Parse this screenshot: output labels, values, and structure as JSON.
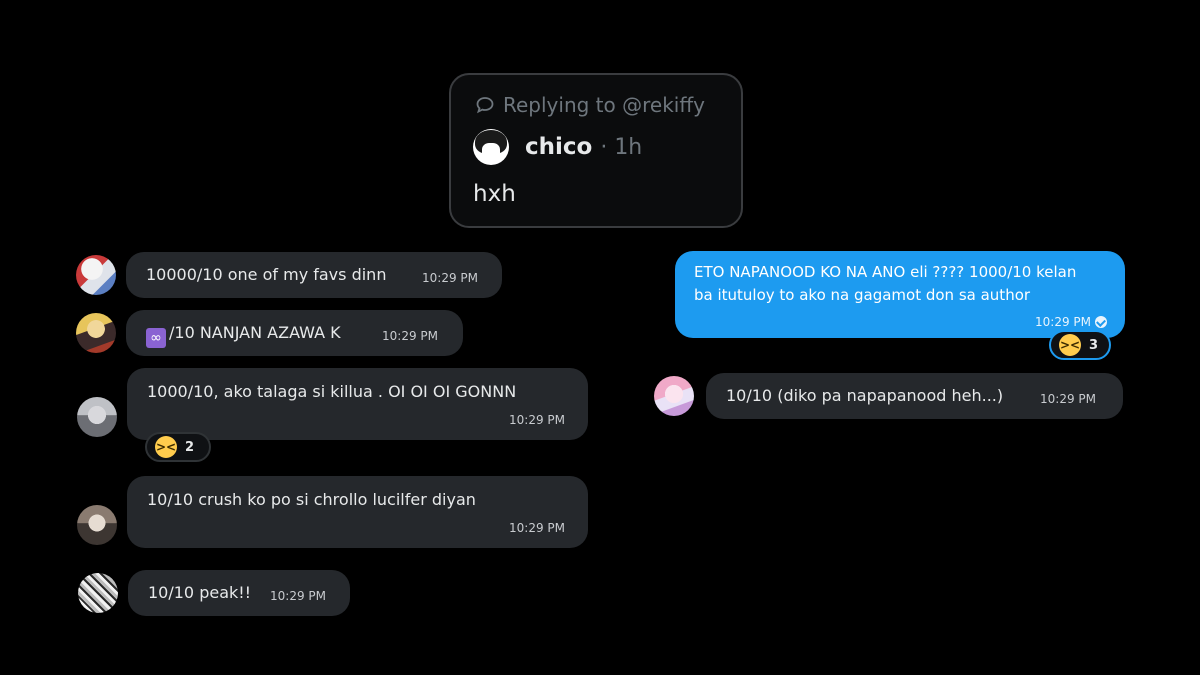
{
  "quoted_post": {
    "replying_label": "Replying to @rekiffy",
    "author": "chico",
    "time": "· 1h",
    "text": "hxh"
  },
  "messages_left": [
    {
      "text": "10000/10 one of my favs dinn",
      "time": "10:29 PM"
    },
    {
      "text": "/10 NANJAN AZAWA K",
      "time": "10:29 PM",
      "icon": "infinity-emoji"
    },
    {
      "text": "1000/10, ako talaga si killua . OI OI OI GONNN",
      "time": "10:29 PM",
      "reaction": {
        "emoji": "laughing-emoji",
        "count": "2"
      }
    },
    {
      "text": "10/10 crush ko po si chrollo lucilfer diyan",
      "time": "10:29 PM"
    },
    {
      "text": "10/10 peak!!",
      "time": "10:29 PM"
    }
  ],
  "messages_right": [
    {
      "line1": "ETO NAPANOOD KO NA ANO eli ???? 1000/10 kelan",
      "line2": "ba itutuloy to ako na gagamot don sa author",
      "time": "10:29 PM",
      "reaction": {
        "emoji": "laughing-emoji",
        "count": "3"
      }
    },
    {
      "text": "10/10 (diko pa napapanood heh...)",
      "time": "10:29 PM"
    }
  ],
  "colors": {
    "background": "#000000",
    "bubble": "#25282c",
    "own_bubble": "#1d9bf0",
    "muted": "#6e767d"
  }
}
